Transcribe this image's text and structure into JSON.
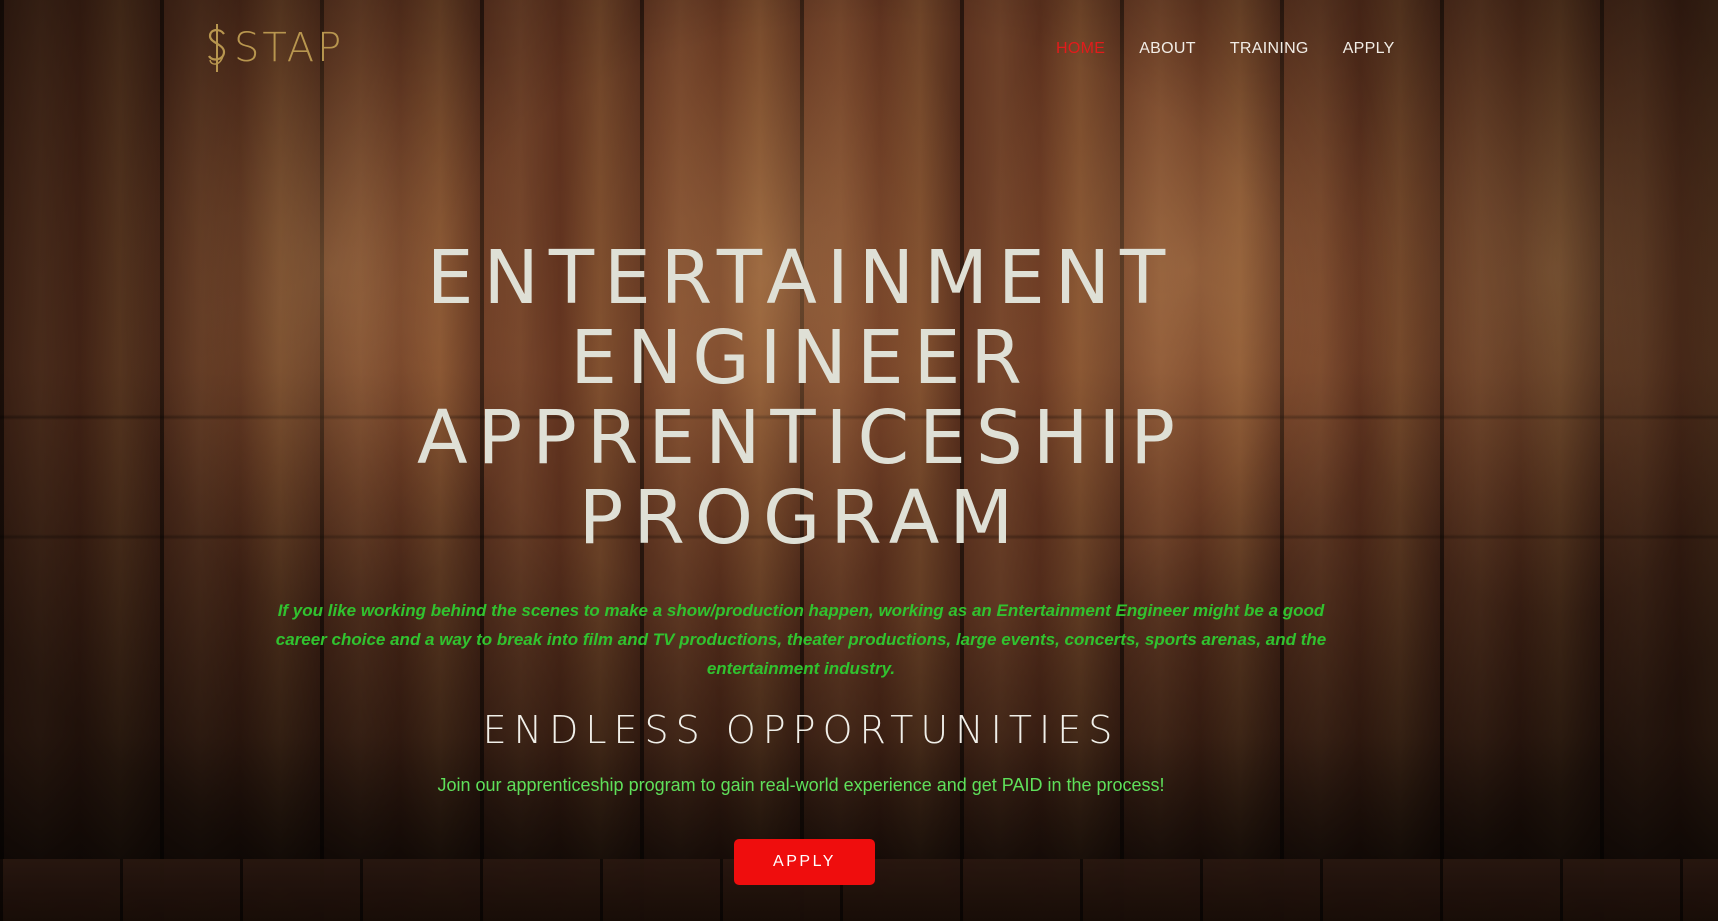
{
  "colors": {
    "logo": "#b8964f",
    "nav_text": "#f2ede6",
    "nav_active": "#e21b1b",
    "title": "#dfe0d6",
    "intro_green": "#31c22f",
    "tagline_green": "#5fe05a",
    "button_red": "#ef0d0d"
  },
  "header": {
    "logo_text": "STAP",
    "logo_icon": "dollar-s-icon",
    "nav": [
      {
        "label": "HOME",
        "active": true
      },
      {
        "label": "ABOUT",
        "active": false
      },
      {
        "label": "TRAINING",
        "active": false
      },
      {
        "label": "APPLY",
        "active": false
      }
    ]
  },
  "hero": {
    "title_lines": [
      "ENTERTAINMENT",
      "ENGINEER",
      "APPRENTICESHIP",
      "PROGRAM"
    ],
    "intro": "If you like working behind the scenes to make a show/production happen, working as an Entertainment Engineer might be a good career choice and a way to break into film and TV productions, theater productions, large events, concerts, sports arenas, and the entertainment industry.",
    "subheading": "ENDLESS OPPORTUNITIES",
    "tagline": "Join our apprenticeship program to gain real-world experience and get PAID in the process!",
    "cta_label": "APPLY"
  }
}
